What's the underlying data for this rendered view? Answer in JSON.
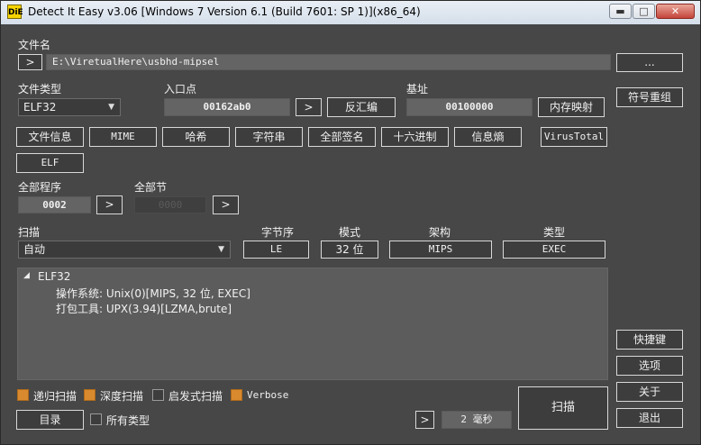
{
  "window": {
    "title": "Detect It Easy v3.06 [Windows 7 Version 6.1 (Build 7601: SP 1)](x86_64)",
    "app_icon_text": "DiE",
    "min_glyph": "▬",
    "max_glyph": "□",
    "close_glyph": "✕"
  },
  "file": {
    "label": "文件名",
    "nav_glyph": ">",
    "path": "E:\\ViretualHere\\usbhd-mipsel",
    "browse_label": "..."
  },
  "info": {
    "filetype_label": "文件类型",
    "filetype_value": "ELF32",
    "entry_label": "入口点",
    "entry_value": "00162ab0",
    "entry_nav": ">",
    "disasm_label": "反汇编",
    "base_label": "基址",
    "base_value": "00100000",
    "memmap_label": "内存映射",
    "symbols_label": "符号重组"
  },
  "tools": {
    "fileinfo": "文件信息",
    "mime": "MIME",
    "hash": "哈希",
    "strings": "字符串",
    "signatures": "全部签名",
    "hex": "十六进制",
    "entropy": "信息熵",
    "virustotal": "VirusTotal",
    "elf": "ELF"
  },
  "programs": {
    "label": "全部程序",
    "value": "0002",
    "nav": ">",
    "sections_label": "全部节",
    "sections_value": "0000",
    "sections_nav": ">"
  },
  "scan": {
    "label": "扫描",
    "mode_value": "自动",
    "endian_label": "字节序",
    "endian_value": "LE",
    "mode_label": "模式",
    "bits_value": "32 位",
    "arch_label": "架构",
    "arch_value": "MIPS",
    "type_label": "类型",
    "type_value": "EXEC"
  },
  "results": {
    "root": "ELF32",
    "lines": [
      "操作系统: Unix(0)[MIPS, 32 位, EXEC]",
      "打包工具: UPX(3.94)[LZMA,brute]"
    ]
  },
  "options": {
    "recursive": "递归扫描",
    "deep": "深度扫描",
    "heuristic": "启发式扫描",
    "verbose": "Verbose",
    "all_types": "所有类型",
    "recursive_checked": true,
    "deep_checked": true,
    "heuristic_checked": false,
    "verbose_checked": true,
    "all_types_checked": false
  },
  "bottom": {
    "directory": "目录",
    "time_nav": ">",
    "time_value": "2 毫秒",
    "scan_button": "扫描"
  },
  "side": {
    "shortcuts": "快捷键",
    "options": "选项",
    "about": "关于",
    "exit": "退出"
  },
  "colors": {
    "background": "#474747",
    "checkbox_on": "#d98a2e",
    "button_border": "#d8d8d8"
  }
}
